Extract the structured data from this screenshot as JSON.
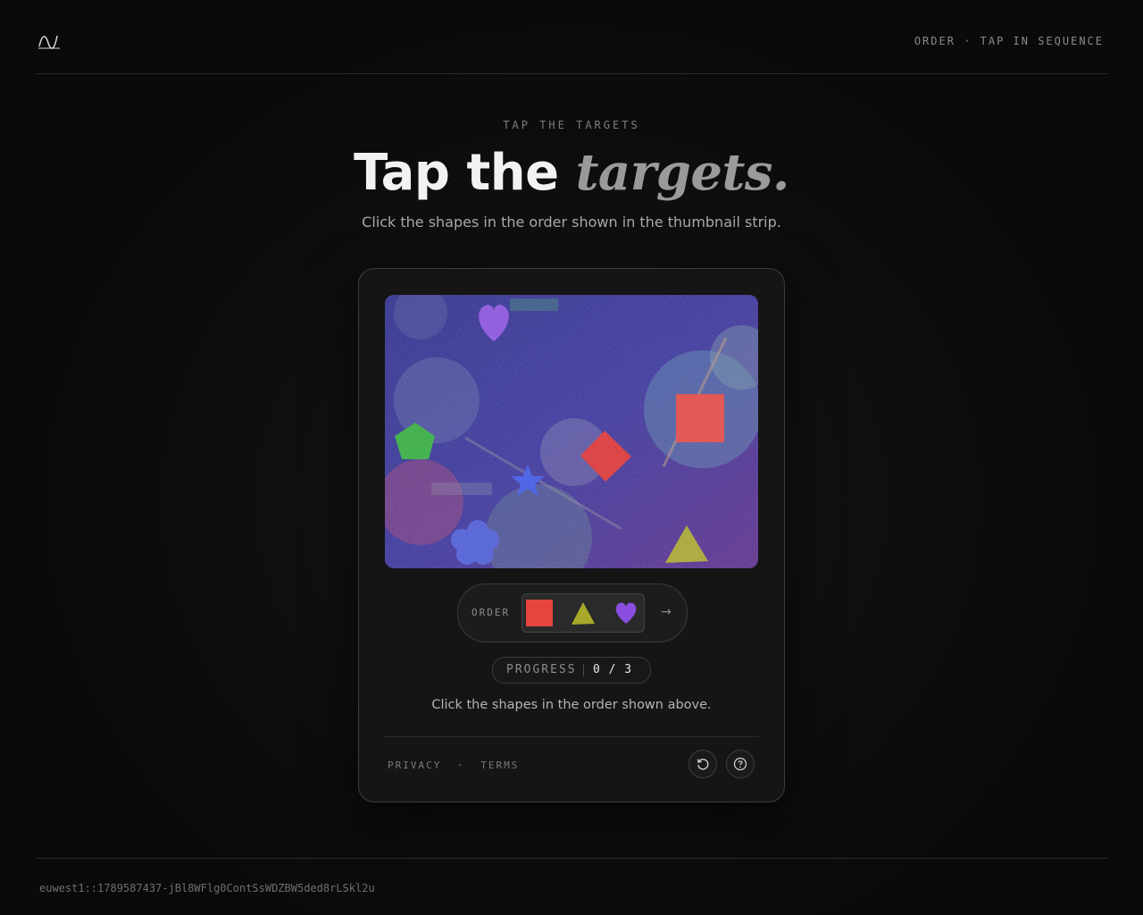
{
  "header": {
    "logo_icon": "wave-logo-icon",
    "mode_label": "ORDER · TAP IN SEQUENCE"
  },
  "hero": {
    "eyebrow": "TAP THE TARGETS",
    "title_main": "Tap the",
    "title_emphasis": "targets.",
    "subtitle": "Click the shapes in the order shown in the thumbnail strip."
  },
  "challenge": {
    "canvas_shapes": [
      {
        "shape": "heart",
        "color": "#8a4fe0"
      },
      {
        "shape": "pentagon",
        "color": "#2fae3a"
      },
      {
        "shape": "star",
        "color": "#3a55e8"
      },
      {
        "shape": "diamond",
        "color": "#e03030"
      },
      {
        "shape": "square",
        "color": "#e6453f"
      },
      {
        "shape": "triangle",
        "color": "#a8a82a"
      },
      {
        "shape": "flower",
        "color": "#4a5ad8"
      }
    ],
    "order": {
      "label": "ORDER",
      "sequence": [
        {
          "shape": "square",
          "color": "#e6453f"
        },
        {
          "shape": "triangle",
          "color": "#a8a82a"
        },
        {
          "shape": "heart",
          "color": "#8a4fe0"
        }
      ],
      "next_icon": "arrow-right-icon",
      "next_glyph": "→"
    },
    "progress": {
      "label": "PROGRESS",
      "value": "0 / 3",
      "completed": 0,
      "total": 3
    },
    "instruction": "Click the shapes in the order shown above."
  },
  "footer": {
    "privacy_label": "PRIVACY",
    "separator": "·",
    "terms_label": "TERMS",
    "refresh_icon": "refresh-icon",
    "help_icon": "help-icon"
  },
  "session_id": "euwest1::1789587437-jBl8WFlg0ContSsWDZBW5ded8rLSkl2u"
}
